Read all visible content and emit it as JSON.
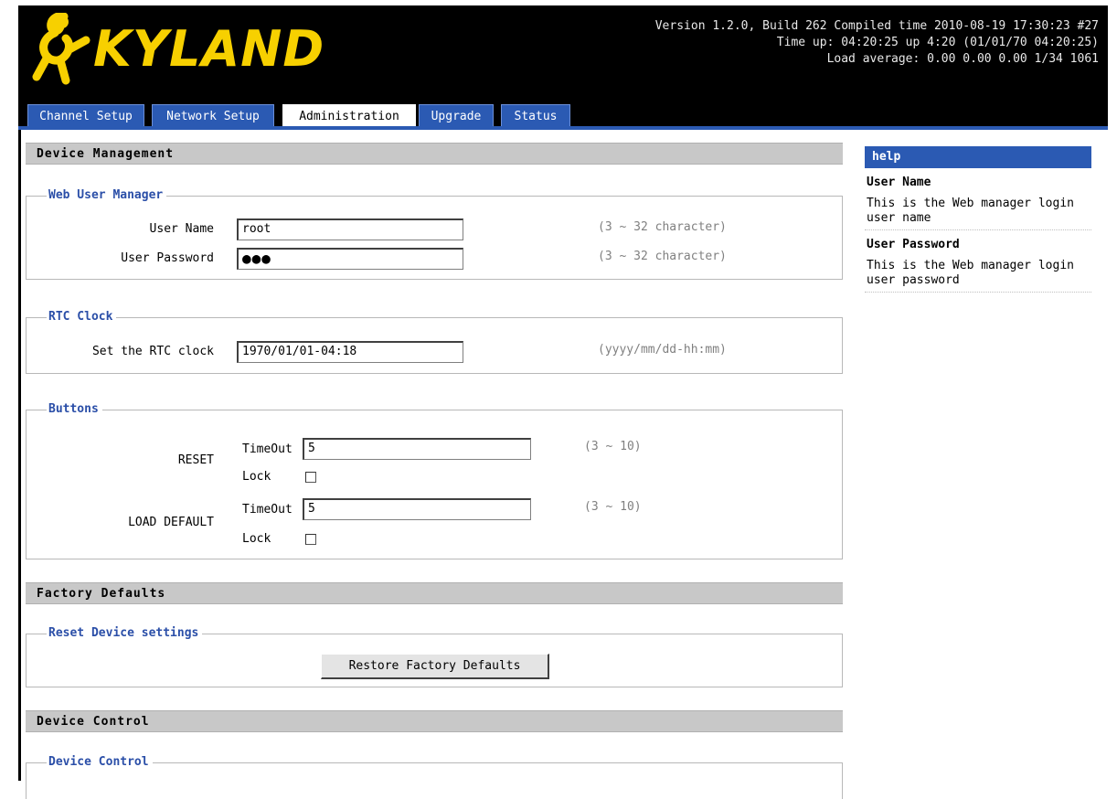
{
  "header": {
    "logo_text": "KYLAND",
    "version_line": "Version 1.2.0, Build 262 Compiled time 2010-08-19 17:30:23 #27",
    "uptime_line": "Time up: 04:20:25 up 4:20 (01/01/70 04:20:25)",
    "load_line": "Load average: 0.00 0.00 0.00 1/34 1061"
  },
  "tabs": [
    {
      "label": "Channel Setup",
      "active": false
    },
    {
      "label": "Network Setup",
      "active": false
    },
    {
      "label": "Administration",
      "active": true
    },
    {
      "label": "Upgrade",
      "active": false
    },
    {
      "label": "Status",
      "active": false
    }
  ],
  "device_management": {
    "title": "Device Management",
    "web_user": {
      "legend": "Web User Manager",
      "user_name_label": "User Name",
      "user_name_value": "root",
      "user_name_hint": "(3 ~ 32 character)",
      "password_label": "User Password",
      "password_value": "●●●",
      "password_hint": "(3 ~ 32 character)"
    },
    "rtc": {
      "legend": "RTC Clock",
      "label": "Set the RTC clock",
      "value": "1970/01/01-04:18",
      "hint": "(yyyy/mm/dd-hh:mm)"
    },
    "buttons": {
      "legend": "Buttons",
      "reset_label": "RESET",
      "reset_timeout_label": "TimeOut",
      "reset_timeout_value": "5",
      "reset_hint": "(3 ~ 10)",
      "reset_lock_label": "Lock",
      "load_default_label": "LOAD DEFAULT",
      "load_timeout_label": "TimeOut",
      "load_timeout_value": "5",
      "load_hint": "(3 ~ 10)",
      "load_lock_label": "Lock"
    }
  },
  "factory_defaults": {
    "title": "Factory Defaults",
    "legend": "Reset Device settings",
    "button_label": "Restore Factory Defaults"
  },
  "device_control": {
    "title": "Device Control",
    "legend": "Device Control"
  },
  "help": {
    "title": "help",
    "items": [
      {
        "title": "User Name",
        "text": "This is the Web manager login user name"
      },
      {
        "title": "User Password",
        "text": "This is the Web manager login user password"
      }
    ]
  },
  "colors": {
    "tab_blue": "#2b5ab3",
    "legend_blue": "#2b4fa8",
    "logo_yellow": "#f7d000"
  }
}
